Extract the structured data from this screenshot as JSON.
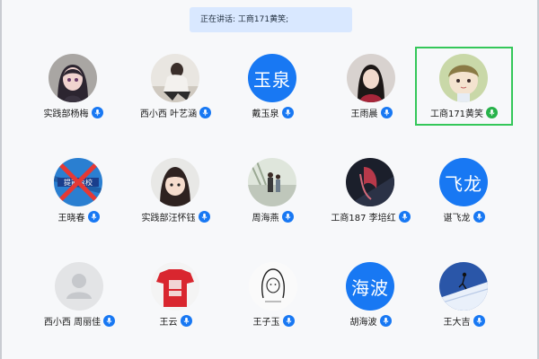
{
  "speaking": {
    "text": "正在讲话: 工商171黄笑;"
  },
  "colors": {
    "mic": "#1878f3",
    "mic_active": "#27b24a",
    "active_border": "#34c759",
    "text_avatar": "#1878f3"
  },
  "participants": [
    {
      "name": "实践部杨梅",
      "avatar": "photo",
      "mic": "mic-icon"
    },
    {
      "name": "西小西 叶艺涵",
      "avatar": "photo",
      "mic": "mic-icon"
    },
    {
      "name": "戴玉泉",
      "avatar_text": "玉泉",
      "mic": "mic-icon"
    },
    {
      "name": "王雨晨",
      "avatar": "photo",
      "mic": "mic-icon"
    },
    {
      "name": "工商171黄笑",
      "avatar": "photo",
      "mic": "mic-speaking-icon",
      "active": true
    },
    {
      "name": "王晓春",
      "avatar": "photo",
      "mic": "mic-icon"
    },
    {
      "name": "实践部汪怀钰",
      "avatar": "photo",
      "mic": "mic-icon"
    },
    {
      "name": "周海燕",
      "avatar": "photo",
      "mic": "mic-icon"
    },
    {
      "name": "工商187 李培红",
      "avatar": "photo",
      "mic": "mic-icon"
    },
    {
      "name": "谌飞龙",
      "avatar_text": "飞龙",
      "mic": "mic-icon"
    },
    {
      "name": "西小西 周丽佳",
      "avatar": "default-user-icon",
      "mic": "mic-icon"
    },
    {
      "name": "王云",
      "avatar": "photo",
      "mic": "mic-icon"
    },
    {
      "name": "王子玉",
      "avatar": "photo",
      "mic": "mic-icon"
    },
    {
      "name": "胡海波",
      "avatar_text": "海波",
      "mic": "mic-icon"
    },
    {
      "name": "王大吉",
      "avatar": "photo",
      "mic": "mic-icon"
    }
  ]
}
